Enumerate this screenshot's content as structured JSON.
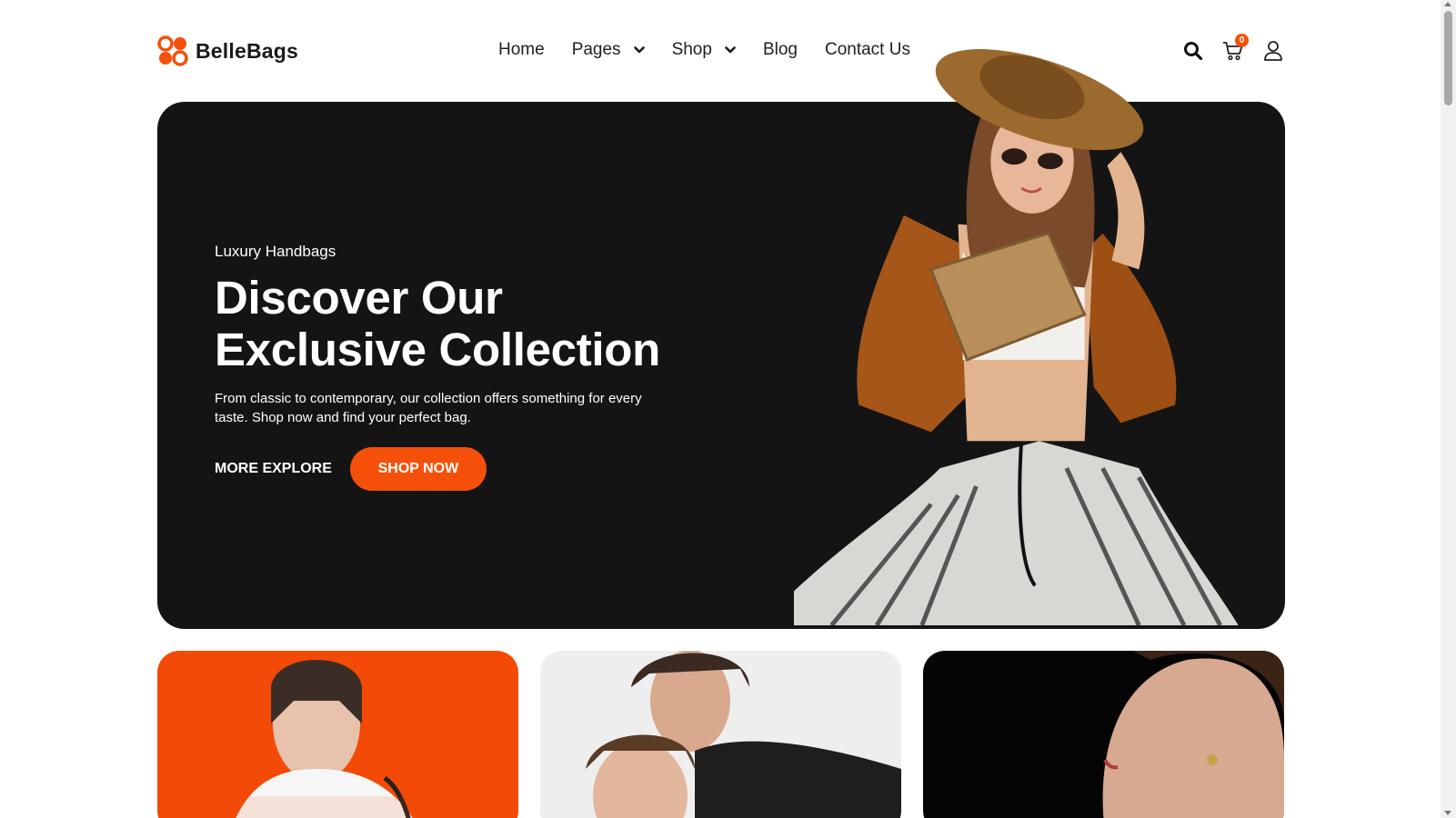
{
  "brand": {
    "name": "BelleBags",
    "accent": "#f5500a",
    "logo_icon": "clover-logo-icon"
  },
  "nav": {
    "items": [
      {
        "label": "Home",
        "has_dropdown": false
      },
      {
        "label": "Pages",
        "has_dropdown": true
      },
      {
        "label": "Shop",
        "has_dropdown": true
      },
      {
        "label": "Blog",
        "has_dropdown": false
      },
      {
        "label": "Contact Us",
        "has_dropdown": false
      }
    ]
  },
  "header_icons": {
    "search": "search-icon",
    "cart": "cart-icon",
    "cart_count": "0",
    "account": "user-icon"
  },
  "hero": {
    "eyebrow": "Luxury Handbags",
    "title_line1": "Discover Our",
    "title_line2": "Exclusive Collection",
    "description": "From classic to contemporary, our collection offers something for every taste. Shop now and find your perfect bag.",
    "secondary_cta": "MORE EXPLORE",
    "primary_cta": "SHOP NOW",
    "background": "#151415"
  },
  "cards": [
    {
      "name": "card-orange",
      "background": "#f34a07"
    },
    {
      "name": "card-light",
      "background": "#eeeeee"
    },
    {
      "name": "card-dark",
      "background": "#050505"
    }
  ]
}
